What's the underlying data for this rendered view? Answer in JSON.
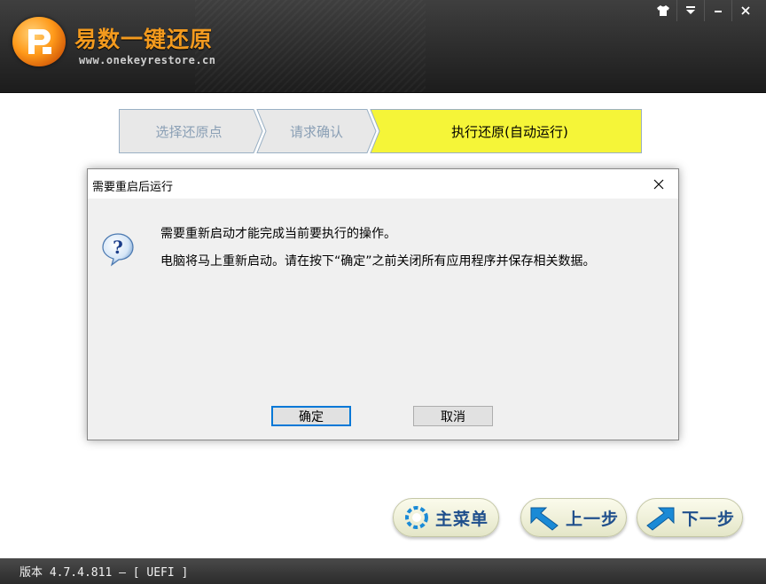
{
  "header": {
    "title": "易数一键还原",
    "url": "www.onekeyrestore.cn",
    "logo_icon": "onekeyrestore-logo-icon",
    "window_controls": [
      {
        "name": "skin-button",
        "glyph": "👕"
      },
      {
        "name": "menu-button",
        "glyph": "▼"
      },
      {
        "name": "minimize-button",
        "glyph": "–"
      },
      {
        "name": "close-button",
        "glyph": "×"
      }
    ]
  },
  "steps": [
    {
      "label": "选择还原点",
      "state": "done"
    },
    {
      "label": "请求确认",
      "state": "done"
    },
    {
      "label": "执行还原(自动运行)",
      "state": "active"
    }
  ],
  "dialog": {
    "title": "需要重启后运行",
    "icon": "question-icon",
    "line1": "需要重新启动才能完成当前要执行的操作。",
    "line2": "电脑将马上重新启动。请在按下“确定”之前关闭所有应用程序并保存相关数据。",
    "ok_label": "确定",
    "cancel_label": "取消"
  },
  "nav": {
    "main_menu": "主菜单",
    "prev": "上一步",
    "next": "下一步"
  },
  "status": {
    "version_text": "版本 4.7.4.811 — [ UEFI ]"
  },
  "colors": {
    "active_step": "#f5f538",
    "inactive_step": "#e8e8e8",
    "title_orange": "#f39a1e",
    "nav_text": "#1f4f8c"
  }
}
